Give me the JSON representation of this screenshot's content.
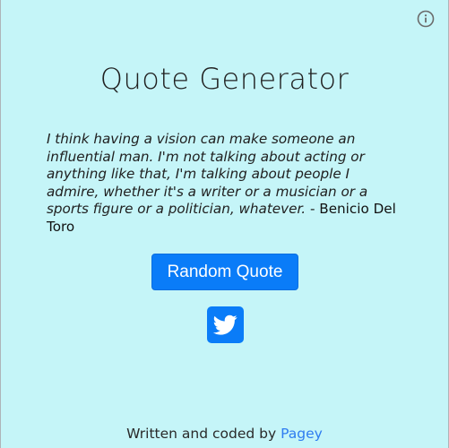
{
  "header": {
    "info_icon": "info-circle-icon",
    "title": "Quote Generator"
  },
  "quote": {
    "text": "I think having a vision can make someone an influential man. I'm not talking about acting or anything like that, I'm talking about people I admire, whether it's a writer or a musician or a sports figure or a politician, whatever.",
    "separator": " - ",
    "author": "Benicio Del Toro"
  },
  "actions": {
    "random_label": "Random Quote",
    "tweet_icon": "twitter-bird-icon"
  },
  "footer": {
    "prefix": "Written and coded by ",
    "author_link": "Pagey"
  },
  "colors": {
    "background": "#c5f5f8",
    "accent": "#0a7cf8",
    "link": "#2e7cf0"
  }
}
